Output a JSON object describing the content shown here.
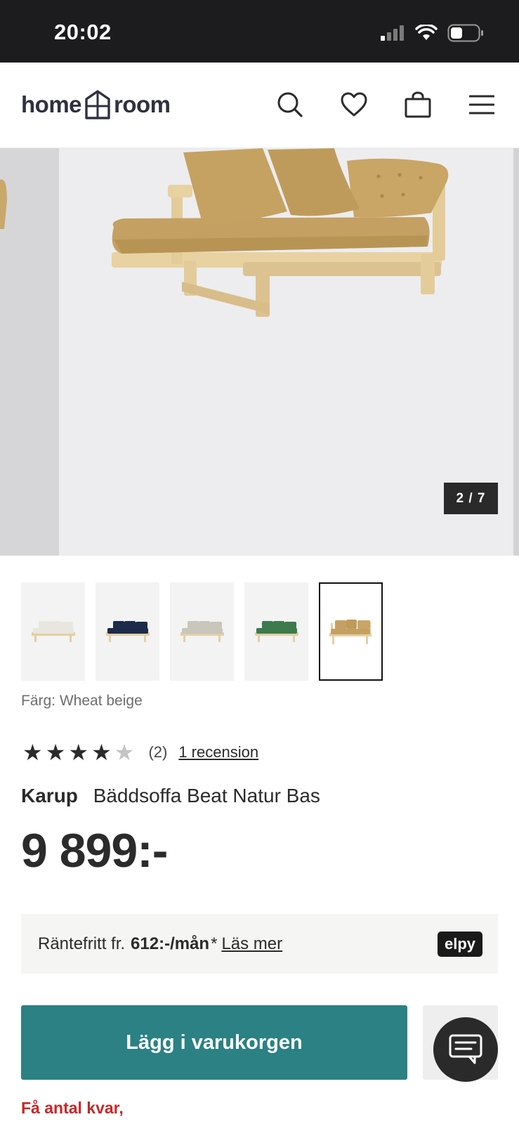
{
  "status_bar": {
    "time": "20:02"
  },
  "header": {
    "logo_left": "home",
    "logo_right": "room",
    "icons": [
      "search-icon",
      "heart-icon",
      "bag-icon",
      "menu-icon"
    ]
  },
  "gallery": {
    "counter": "2 / 7"
  },
  "thumbnails": [
    {
      "color": "#e8e6df",
      "frame": "#e3cfa3"
    },
    {
      "color": "#1e2a4a",
      "frame": "#e3cfa3"
    },
    {
      "color": "#c9c6bb",
      "frame": "#e3cfa3"
    },
    {
      "color": "#3d7a4d",
      "frame": "#e3cfa3"
    },
    {
      "color": "#c4a063",
      "frame": "#e3cfa3",
      "selected": true
    }
  ],
  "color_label": "Färg: Wheat beige",
  "rating": {
    "stars": 4,
    "max": 5,
    "count": "(2)",
    "reviews_link": "1 recension"
  },
  "product": {
    "brand": "Karup",
    "name": "Bäddsoffa Beat Natur Bas",
    "price": "9 899:-"
  },
  "finance": {
    "prefix": "Räntefritt fr.",
    "amount": "612:-/mån",
    "suffix": "*",
    "more": "Läs mer",
    "provider": "elpy"
  },
  "actions": {
    "add_to_cart": "Lägg i varukorgen"
  },
  "stock": "Få antal kvar,",
  "colors": {
    "accent": "#2b8183",
    "stock_warning": "#c62828"
  }
}
